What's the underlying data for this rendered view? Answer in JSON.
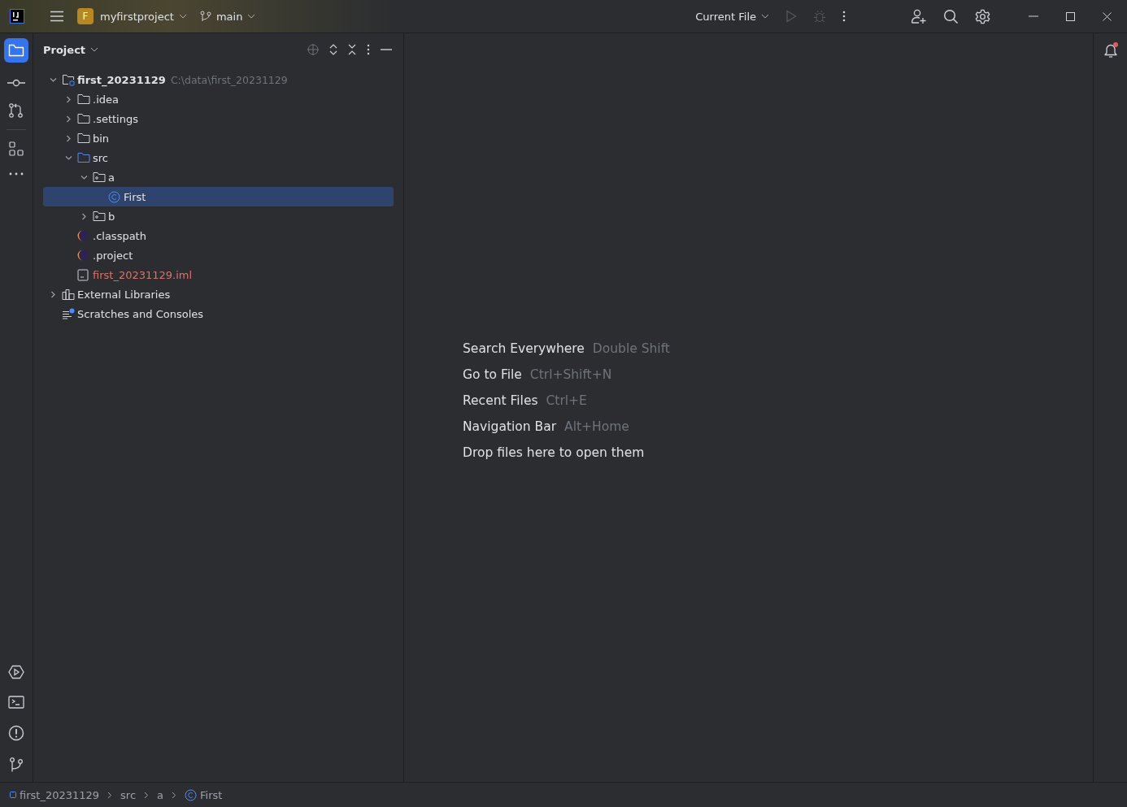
{
  "title_bar": {
    "project": {
      "badge": "F",
      "name": "myfirstproject"
    },
    "branch": "main",
    "run_config": "Current File"
  },
  "project_panel": {
    "title": "Project",
    "tree": [
      {
        "label": "first_20231129",
        "kind": "module",
        "hint": "C:\\data\\first_20231129",
        "expanded": true,
        "selected": false,
        "children": [
          {
            "label": ".idea",
            "kind": "folder",
            "expanded": false,
            "selected": false
          },
          {
            "label": ".settings",
            "kind": "folder",
            "expanded": false,
            "selected": false
          },
          {
            "label": "bin",
            "kind": "folder",
            "expanded": false,
            "selected": false
          },
          {
            "label": "src",
            "kind": "source-folder",
            "expanded": true,
            "selected": false,
            "children": [
              {
                "label": "a",
                "kind": "package",
                "expanded": true,
                "selected": false,
                "children": [
                  {
                    "label": "First",
                    "kind": "class",
                    "selected": true
                  }
                ]
              },
              {
                "label": "b",
                "kind": "package",
                "expanded": false,
                "selected": false
              }
            ]
          },
          {
            "label": ".classpath",
            "kind": "eclipse",
            "selected": false
          },
          {
            "label": ".project",
            "kind": "eclipse",
            "selected": false
          },
          {
            "label": "first_20231129.iml",
            "kind": "ignored-file",
            "selected": false
          }
        ]
      },
      {
        "label": "External Libraries",
        "kind": "libraries",
        "expanded": false,
        "selected": false
      },
      {
        "label": "Scratches and Consoles",
        "kind": "scratches",
        "selected": false
      }
    ]
  },
  "editor_hints": [
    {
      "label": "Search Everywhere",
      "shortcut": "Double Shift"
    },
    {
      "label": "Go to File",
      "shortcut": "Ctrl+Shift+N"
    },
    {
      "label": "Recent Files",
      "shortcut": "Ctrl+E"
    },
    {
      "label": "Navigation Bar",
      "shortcut": "Alt+Home"
    },
    {
      "label": "Drop files here to open them"
    }
  ],
  "breadcrumbs": [
    {
      "label": "first_20231129",
      "kind": "module"
    },
    {
      "label": "src",
      "kind": "folder"
    },
    {
      "label": "a",
      "kind": "folder"
    },
    {
      "label": "First",
      "kind": "class"
    }
  ],
  "notifications": {
    "unread": true
  }
}
